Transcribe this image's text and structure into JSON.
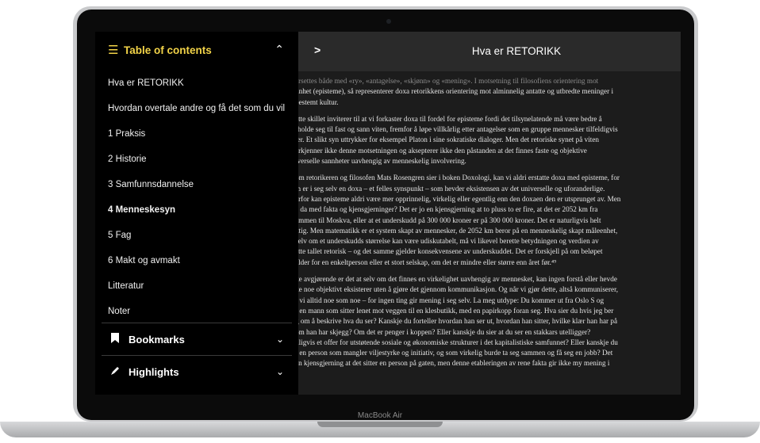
{
  "device": {
    "label": "MacBook Air"
  },
  "sidebar": {
    "toc_title": "Table of contents",
    "toc_items": [
      "Hva er RETORIKK",
      "Hvordan overtale andre og få det som du vil",
      "1 Praksis",
      "2 Historie",
      "3 Samfunnsdannelse",
      "4 Menneskesyn",
      "5 Fag",
      "6 Makt og avmakt",
      "Litteratur",
      "Noter"
    ],
    "active_item": "4 Menneskesyn",
    "bookmarks_label": "Bookmarks",
    "highlights_label": "Highlights"
  },
  "reader": {
    "title": "Hva er RETORIKK",
    "paragraphs": [
      [
        "ersettes både med «ry», «antagelse», «skjønn» og «mening». I motsetning til filosofiens orientering mot",
        "nnhet (episteme), så representerer doxa retorikkens orientering mot alminnelig antatte og utbredte meninger i",
        "bestemt kultur."
      ],
      [
        "ette skillet inviterer til at vi forkaster doxa til fordel for episteme fordi det tilsynelatende må være bedre å",
        "rholde seg til fast og sann viten, fremfor å løpe villkårlig etter antagelser som en gruppe mennesker tilfeldigvis",
        "ler. Et slikt syn uttrykker for eksempel Platon i sine sokratiske dialoger. Men det retoriske synet på viten",
        "erkjenner ikke denne motsetningen og aksepterer ikke den påstanden at det finnes faste og objektive",
        "iverselle sannheter uavhengig av menneskelig involvering."
      ],
      [
        "om retorikeren og filosofen Mats Rosengren sier i boken Doxologi, kan vi aldri erstatte doxa med episteme, for",
        "m er i seg selv en doxa – et felles synspunkt – som hevder eksistensen av det universelle og uforanderlige.",
        "erfor kan episteme aldri være mer opprinnelig, virkelig eller egentlig enn den doxaen den er utsprunget av. Men",
        "a da med fakta og kjensgjerninger? Det er jo en kjensgjerning at to pluss to er fire, at det er 2052 km fra",
        "ammen til Moskva, eller at et underskudd på 300 000 kroner er på 300 000 kroner. Det er naturligvis helt",
        "ktig. Men matematikk er et system skapt av mennesker, de 2052 km beror på en menneskelig skapt måleenhet,",
        "selv om et underskudds størrelse kan være udiskutabelt, må vi likevel berette betydningen og verdien av",
        "ette tallet retorisk – og det samme gjelder konsekvensene av underskuddet. Det er forskjell på om beløpet",
        "elder for en enkeltperson eller et stort selskap, om det er mindre eller større enn året før.⁴⁹"
      ],
      [
        "ke avgjørende er det at selv om det finnes en virkelighet uavhengig av mennesket, kan ingen forstå eller hevde",
        "ke noe objektivt eksisterer uten å gjøre det gjennom kommunikasjon. Og når vi gjør dette, altså kommuniserer,",
        "r vi alltid noe som noe – for ingen ting gir mening i seg selv. La meg utdype: Du kommer ut fra Oslo S og",
        "r en mann som sitter lenet mot veggen til en klesbutikk, med en papirkopp foran seg. Hva sier du hvis jeg ber",
        "g om å beskrive hva du ser? Kanskje du forteller hvordan han ser ut, hvordan han sitter, hvilke klær han har på",
        "om han har skjegg? Om det er penger i koppen? Eller kanskje du sier at du ser en stakkars utelligger?",
        "uligvis et offer for utstøtende sosiale og økonomiske strukturer i det kapitalistiske samfunnet? Eller kanskje du",
        "r en person som mangler viljestyrke og initiativ, og som virkelig burde ta seg sammen og få seg en jobb? Det",
        "en kjensgjerning at det sitter en person på gaten, men denne etableringen av rene fakta gir ikke my mening i"
      ]
    ]
  },
  "colors": {
    "accent": "#f2d348",
    "sidebar_bg": "#000000",
    "reader_bg": "#1c1c1c"
  }
}
